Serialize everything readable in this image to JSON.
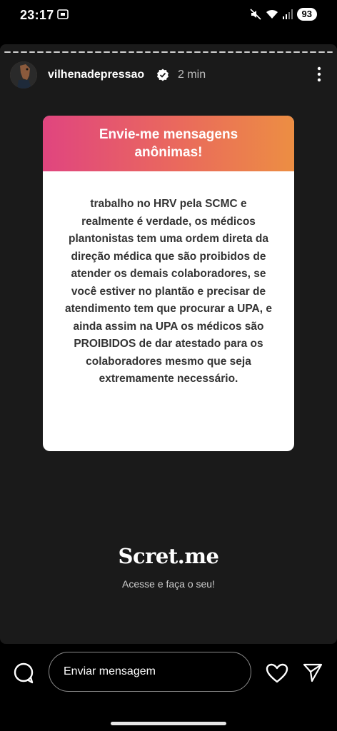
{
  "status_bar": {
    "time": "23:17",
    "battery": "93",
    "icons": [
      "screen-cast-icon",
      "mute-icon",
      "wifi-icon",
      "signal-icon"
    ]
  },
  "story": {
    "username": "vilhenadepressao",
    "time_ago": "2 min",
    "card": {
      "title": "Envie-me mensagens anônimas!",
      "message": "trabalho no HRV pela SCMC e realmente é verdade, os médicos plantonistas tem uma ordem direta da direção médica que são proibidos de atender os demais colaboradores, se você estiver no plantão e precisar de atendimento tem que procurar a UPA, e ainda assim na UPA os médicos são PROIBIDOS de dar atestado para os colaboradores mesmo que seja extremamente necessário.",
      "gradient_colors": [
        "#e0457f",
        "#ec8e43"
      ]
    },
    "brand": "Scret.me",
    "brand_tagline": "Acesse e faça o seu!"
  },
  "bottom_bar": {
    "message_placeholder": "Enviar mensagem"
  }
}
